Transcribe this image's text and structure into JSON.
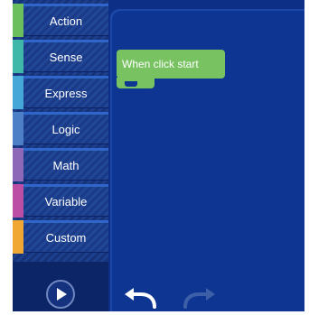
{
  "categories": [
    {
      "label": "Action",
      "color": "#6bbf5c"
    },
    {
      "label": "Sense",
      "color": "#3fb8a9"
    },
    {
      "label": "Express",
      "color": "#45a6d8"
    },
    {
      "label": "Logic",
      "color": "#4d7fc7"
    },
    {
      "label": "Math",
      "color": "#8d68b8"
    },
    {
      "label": "Variable",
      "color": "#bd4ea6"
    },
    {
      "label": "Custom",
      "color": "#f0a733"
    }
  ],
  "workspace": {
    "block_text": "When click start",
    "block_color": "#78c262"
  },
  "toolbar": {
    "play_icon": "play-icon",
    "undo_icon": "undo-icon",
    "redo_icon": "redo-icon"
  }
}
